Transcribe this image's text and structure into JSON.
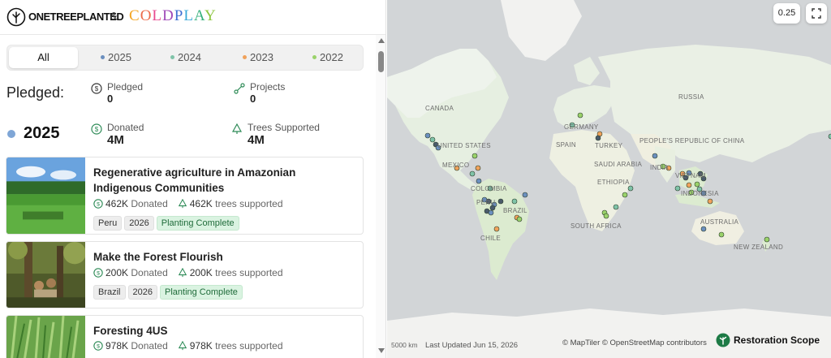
{
  "header": {
    "org_name": "ONETREEPLANTED",
    "ampersand": "&",
    "partner": "COLDPLAY",
    "partner_colors": [
      "#f4a521",
      "#ec6a4a",
      "#e84a8f",
      "#a04ab8",
      "#3d6fd1",
      "#39a9d9",
      "#36b17d",
      "#8dc63f"
    ]
  },
  "tabs": [
    {
      "label": "All",
      "active": true
    },
    {
      "label": "2025",
      "color": "#6b8fbf"
    },
    {
      "label": "2024",
      "color": "#7fc3a8"
    },
    {
      "label": "2023",
      "color": "#f0a25b"
    },
    {
      "label": "2022",
      "color": "#9ad26a"
    }
  ],
  "pledged": {
    "label": "Pledged:",
    "pledged_label": "Pledged",
    "pledged_value": "0",
    "projects_label": "Projects",
    "projects_value": "0"
  },
  "year_summary": {
    "year": "2025",
    "dot_color": "#7fa6d6",
    "donated_label": "Donated",
    "donated_value": "4M",
    "trees_label": "Trees Supported",
    "trees_value": "4M"
  },
  "projects": [
    {
      "title": "Regenerative agriculture in Amazonian Indigenous Communities",
      "donated": "462K",
      "donated_suffix": "Donated",
      "trees": "462K",
      "trees_suffix": "trees supported",
      "tags": [
        "Peru",
        "2026"
      ],
      "status": "Planting Complete"
    },
    {
      "title": "Make the Forest Flourish",
      "donated": "200K",
      "donated_suffix": "Donated",
      "trees": "200K",
      "trees_suffix": "trees supported",
      "tags": [
        "Brazil",
        "2026"
      ],
      "status": "Planting Complete"
    },
    {
      "title": "Foresting 4US",
      "donated": "978K",
      "donated_suffix": "Donated",
      "trees": "978K",
      "trees_suffix": "trees supported",
      "tags": [],
      "status": ""
    }
  ],
  "map": {
    "zoom": "0.25",
    "labels": {
      "canada": "CANADA",
      "us": "UNITED STATES",
      "mexico": "MEXICO",
      "colombia": "COLOMBIA",
      "peru": "PERU",
      "brazil": "BRAZIL",
      "chile": "CHILE",
      "germany": "GERMANY",
      "spain": "SPAIN",
      "turkey": "TURKEY",
      "saudi": "SAUDI ARABIA",
      "ethiopia": "ETHIOPIA",
      "south_africa": "SOUTH AFRICA",
      "russia": "RUSSIA",
      "china": "PEOPLE'S REPUBLIC OF CHINA",
      "india": "INDIA",
      "vietnam": "VIETNAM",
      "indonesia": "INDONESIA",
      "australia": "AUSTRALIA",
      "new_zealand": "NEW ZEALAND"
    },
    "scale": "5000 km",
    "last_updated": "Last Updated Jun 15, 2026",
    "attribution": "© MapTiler  © OpenStreetMap contributors",
    "brand": "Restoration Scope"
  }
}
